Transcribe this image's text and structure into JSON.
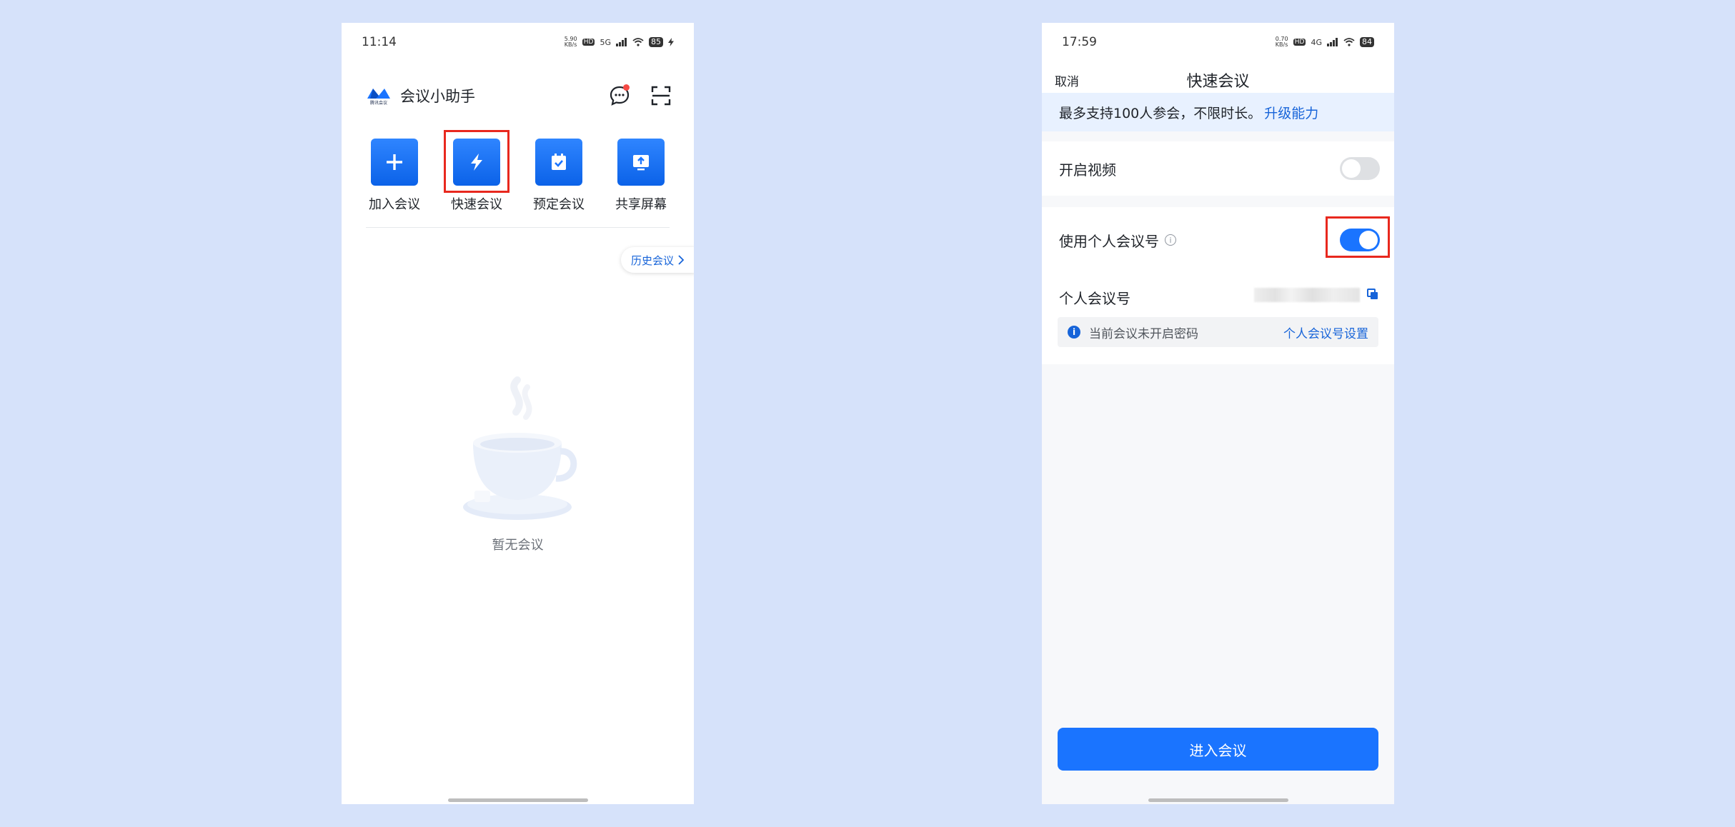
{
  "left": {
    "status": {
      "time": "11:14",
      "speed": "5.90 KB/s",
      "network": "5G",
      "hd": "HD",
      "battery": "85"
    },
    "header": {
      "logo_caption": "腾讯会议",
      "title": "会议小助手"
    },
    "actions": [
      {
        "label": "加入会议",
        "icon": "plus-icon"
      },
      {
        "label": "快速会议",
        "icon": "lightning-icon"
      },
      {
        "label": "预定会议",
        "icon": "calendar-check-icon"
      },
      {
        "label": "共享屏幕",
        "icon": "share-screen-icon"
      }
    ],
    "history_label": "历史会议",
    "empty_text": "暂无会议"
  },
  "right": {
    "status": {
      "time": "17:59",
      "speed": "0.70 KB/s",
      "network": "4G",
      "hd": "HD",
      "battery": "84"
    },
    "nav": {
      "cancel": "取消",
      "title": "快速会议"
    },
    "notice": {
      "text": "最多支持100人参会，不限时长。",
      "link": "升级能力"
    },
    "rows": {
      "video": {
        "label": "开启视频",
        "on": false
      },
      "personal_id": {
        "label": "使用个人会议号",
        "on": true
      },
      "meeting_id": {
        "label": "个人会议号"
      }
    },
    "password_notice": {
      "text": "当前会议未开启密码",
      "link": "个人会议号设置"
    },
    "enter_button": "进入会议"
  },
  "colors": {
    "accent": "#1a74ff",
    "highlight": "#e8281e",
    "background": "#d6e2fa"
  }
}
